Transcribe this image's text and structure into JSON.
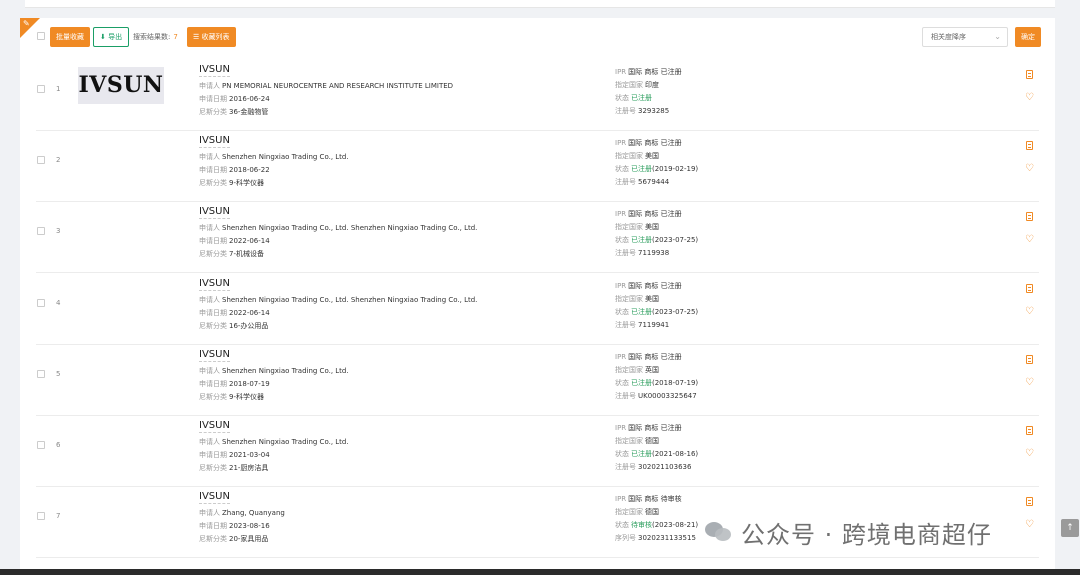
{
  "toolbar": {
    "batch_favorite": "批量收藏",
    "export": "导出",
    "result_count_label": "搜索结果数:",
    "result_count": "7",
    "favorites_list": "收藏列表",
    "sort_selected": "相关度降序",
    "confirm": "确定"
  },
  "labels": {
    "applicant": "申请人",
    "apply_date": "申请日期",
    "nice_class": "尼斯分类",
    "ipr": "IPR",
    "country": "指定国家",
    "status": "状态",
    "reg_no": "注册号",
    "serial_no": "序列号"
  },
  "results": [
    {
      "index": "1",
      "name": "IVSUN",
      "logo_text": "IVSUN",
      "applicant": "PN MEMORIAL NEUROCENTRE AND RESEARCH INSTITUTE LIMITED",
      "apply_date": "2016-06-24",
      "nice_class": "36-金融物管",
      "ipr": "国际 商标 已注册",
      "country": "印度",
      "status": "已注册",
      "status_date": "",
      "number_label_key": "reg_no",
      "number": "3293285"
    },
    {
      "index": "2",
      "name": "IVSUN",
      "logo_text": "",
      "applicant": "Shenzhen Ningxiao Trading Co., Ltd.",
      "apply_date": "2018-06-22",
      "nice_class": "9-科学仪器",
      "ipr": "国际 商标 已注册",
      "country": "美国",
      "status": "已注册",
      "status_date": "(2019-02-19)",
      "number_label_key": "reg_no",
      "number": "5679444"
    },
    {
      "index": "3",
      "name": "IVSUN",
      "logo_text": "",
      "applicant": "Shenzhen Ningxiao Trading Co., Ltd.  Shenzhen Ningxiao Trading Co., Ltd.",
      "apply_date": "2022-06-14",
      "nice_class": "7-机械设备",
      "ipr": "国际 商标 已注册",
      "country": "美国",
      "status": "已注册",
      "status_date": "(2023-07-25)",
      "number_label_key": "reg_no",
      "number": "7119938"
    },
    {
      "index": "4",
      "name": "IVSUN",
      "logo_text": "",
      "applicant": "Shenzhen Ningxiao Trading Co., Ltd.  Shenzhen Ningxiao Trading Co., Ltd.",
      "apply_date": "2022-06-14",
      "nice_class": "16-办公用品",
      "ipr": "国际 商标 已注册",
      "country": "美国",
      "status": "已注册",
      "status_date": "(2023-07-25)",
      "number_label_key": "reg_no",
      "number": "7119941"
    },
    {
      "index": "5",
      "name": "IVSUN",
      "logo_text": "",
      "applicant": "Shenzhen Ningxiao Trading Co., Ltd.",
      "apply_date": "2018-07-19",
      "nice_class": "9-科学仪器",
      "ipr": "国际 商标 已注册",
      "country": "英国",
      "status": "已注册",
      "status_date": "(2018-07-19)",
      "number_label_key": "reg_no",
      "number": "UK00003325647"
    },
    {
      "index": "6",
      "name": "IVSUN",
      "logo_text": "",
      "applicant": "Shenzhen Ningxiao Trading Co., Ltd.",
      "apply_date": "2021-03-04",
      "nice_class": "21-厨房洁具",
      "ipr": "国际 商标 已注册",
      "country": "德国",
      "status": "已注册",
      "status_date": "(2021-08-16)",
      "number_label_key": "reg_no",
      "number": "302021103636"
    },
    {
      "index": "7",
      "name": "IVSUN",
      "logo_text": "",
      "applicant": "Zhang, Quanyang",
      "apply_date": "2023-08-16",
      "nice_class": "20-家具用品",
      "ipr": "国际 商标 待审核",
      "country": "德国",
      "status": "待审核",
      "status_date": "(2023-08-21)",
      "number_label_key": "serial_no",
      "number": "3020231133515"
    }
  ],
  "watermark": {
    "text": "公众号 · 跨境电商超仔"
  },
  "icons": {
    "pin": "pin-icon",
    "export": "download-icon",
    "list": "list-icon",
    "doc": "document-icon",
    "heart": "heart-icon",
    "scroll_up": "arrow-up-icon"
  },
  "colors": {
    "accent": "#f08a24",
    "export_green": "#1a9e66",
    "status_green": "#2a9d5c"
  }
}
